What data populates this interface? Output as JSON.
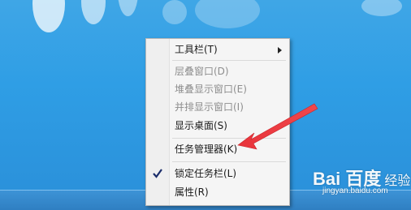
{
  "context_menu": {
    "items": [
      {
        "label": "工具栏(T)",
        "disabled": false,
        "submenu": true,
        "checked": false
      },
      {
        "label": "层叠窗口(D)",
        "disabled": true,
        "submenu": false,
        "checked": false
      },
      {
        "label": "堆叠显示窗口(E)",
        "disabled": true,
        "submenu": false,
        "checked": false
      },
      {
        "label": "并排显示窗口(I)",
        "disabled": true,
        "submenu": false,
        "checked": false
      },
      {
        "label": "显示桌面(S)",
        "disabled": false,
        "submenu": false,
        "checked": false
      },
      {
        "label": "任务管理器(K)",
        "disabled": false,
        "submenu": false,
        "checked": false
      },
      {
        "label": "锁定任务栏(L)",
        "disabled": false,
        "submenu": false,
        "checked": true
      },
      {
        "label": "属性(R)",
        "disabled": false,
        "submenu": false,
        "checked": false
      }
    ]
  },
  "watermark": {
    "logo": "Bai 百度",
    "jingyan": "经验",
    "url": "jingyan.baidu.com"
  },
  "colors": {
    "desktop": "#2f9ee5",
    "annotation_arrow": "#e8333a",
    "menu_bg": "#f5f5f5"
  }
}
